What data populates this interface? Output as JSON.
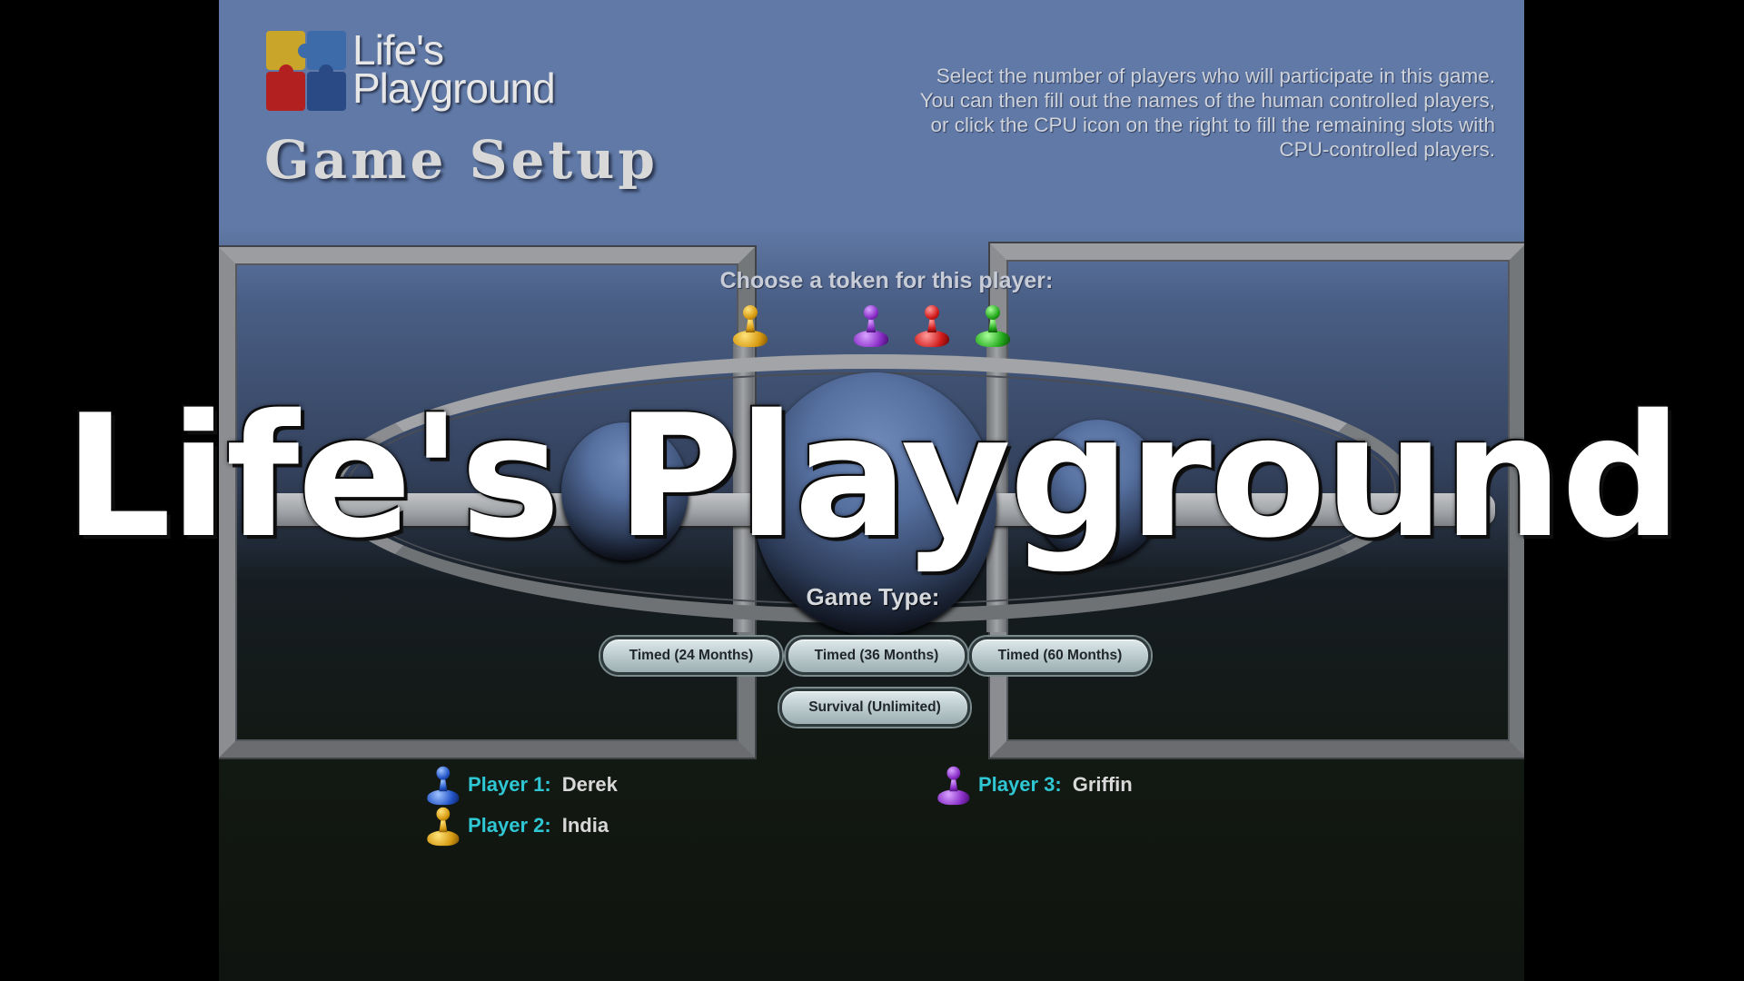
{
  "logo": {
    "line1": "Life's",
    "line2": "Playground"
  },
  "header": {
    "title": "Game Setup",
    "instructions": [
      "Select the number of players who will participate in this game.",
      "You can then fill out the names of the human controlled players,",
      "or click the CPU icon on the right to fill the remaining slots with",
      "CPU-controlled players."
    ]
  },
  "token_picker": {
    "prompt": "Choose a token for this player:",
    "tokens": [
      "yellow",
      "purple",
      "red",
      "green"
    ]
  },
  "game_type": {
    "label": "Game Type:",
    "options": [
      "Timed (24 Months)",
      "Timed (36 Months)",
      "Timed (60 Months)",
      "Survival (Unlimited)"
    ]
  },
  "players": [
    {
      "label": "Player 1:",
      "name": "Derek",
      "token": "blue"
    },
    {
      "label": "Player 2:",
      "name": "India",
      "token": "yellow"
    },
    {
      "label": "Player 3:",
      "name": "Griffin",
      "token": "purple"
    }
  ],
  "overlay": {
    "title": "Life's Playground"
  },
  "colors": {
    "header_blue": "#6079a6",
    "player_label": "#2fc7d4",
    "frame_gray": "#8a8c8f"
  },
  "icons": [
    "puzzle-logo-icon",
    "pawn-token-icon"
  ]
}
